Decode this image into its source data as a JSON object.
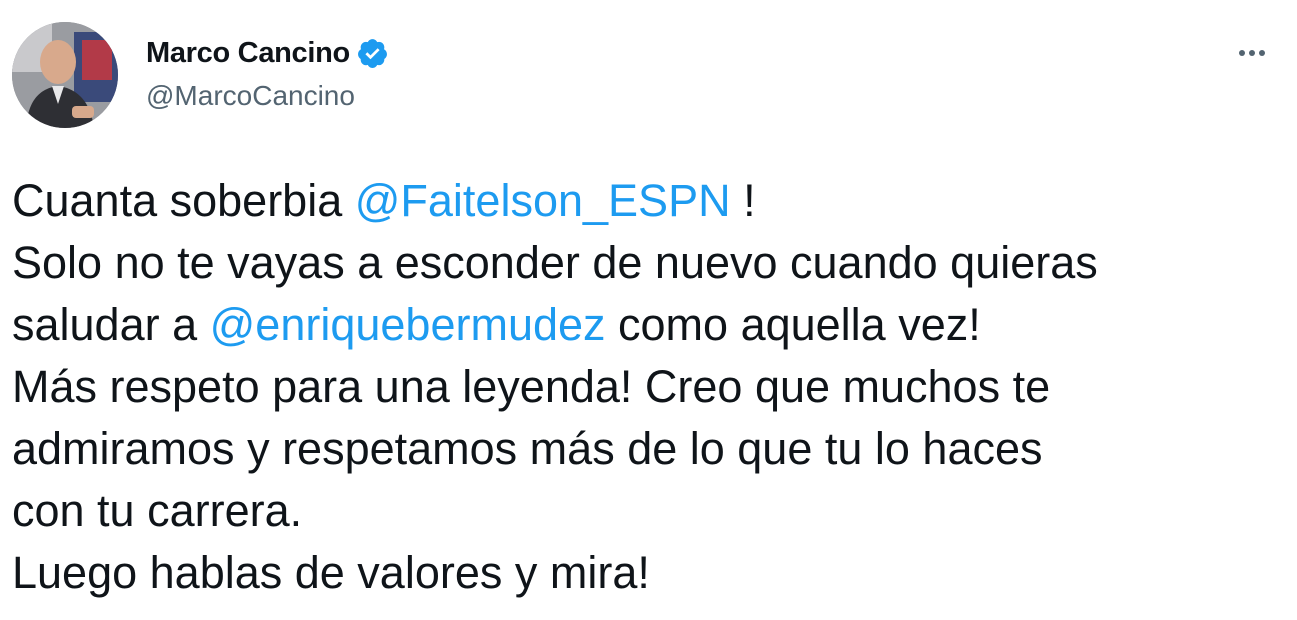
{
  "tweet": {
    "author": {
      "display_name": "Marco Cancino",
      "handle": "@MarcoCancino",
      "verified_icon": "verified-badge-icon",
      "avatar_icon": "avatar-photo"
    },
    "more_icon": "more-options-icon",
    "body": {
      "line1": {
        "pre": "Cuanta soberbia ",
        "mention": "@Faitelson_ESPN",
        "post": " !"
      },
      "line2": "Solo no te vayas a esconder de nuevo cuando quieras",
      "line3": {
        "pre": "saludar a ",
        "mention": "@enriquebermudez",
        "post": " como aquella vez!"
      },
      "line4": "Más respeto para una leyenda! Creo que muchos te",
      "line5": "admiramos y respetamos más de lo que tu lo haces",
      "line6": "con tu carrera.",
      "line7": "Luego hablas de valores y mira!"
    }
  },
  "colors": {
    "text": "#0f1419",
    "secondary": "#536471",
    "link": "#1d9bf0",
    "verified": "#1d9bf0"
  }
}
